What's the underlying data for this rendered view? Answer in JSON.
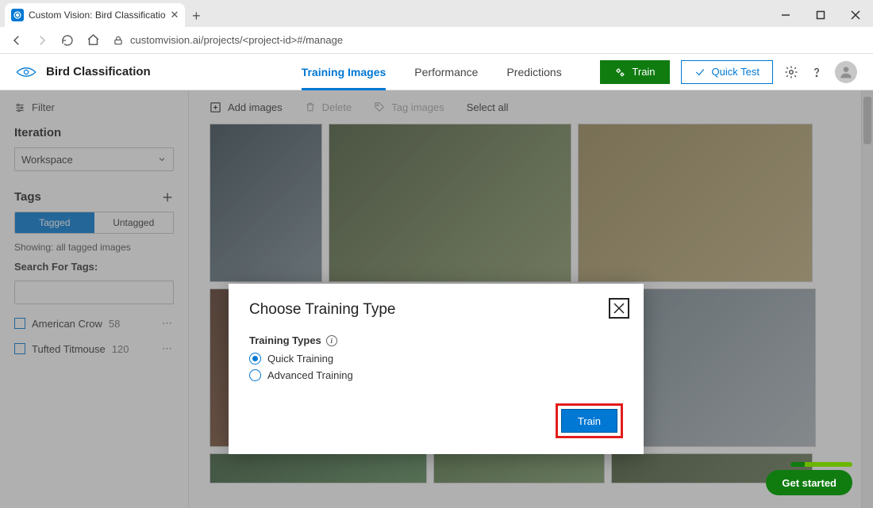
{
  "browser": {
    "tab_title": "Custom Vision: Bird Classificatio",
    "url": "customvision.ai/projects/<project-id>#/manage"
  },
  "header": {
    "project_name": "Bird Classification",
    "tabs": {
      "images": "Training Images",
      "performance": "Performance",
      "predictions": "Predictions"
    },
    "train_btn": "Train",
    "quick_test_btn": "Quick Test"
  },
  "sidebar": {
    "filter_label": "Filter",
    "iteration_label": "Iteration",
    "iteration_value": "Workspace",
    "tags_label": "Tags",
    "pill_tagged": "Tagged",
    "pill_untagged": "Untagged",
    "showing": "Showing: all tagged images",
    "search_label": "Search For Tags:",
    "tags": [
      {
        "name": "American Crow",
        "count": "58"
      },
      {
        "name": "Tufted Titmouse",
        "count": "120"
      }
    ]
  },
  "toolbar": {
    "add_images": "Add images",
    "delete": "Delete",
    "tag_images": "Tag images",
    "select_all": "Select all"
  },
  "modal": {
    "title": "Choose Training Type",
    "types_label": "Training Types",
    "opt_quick": "Quick Training",
    "opt_advanced": "Advanced Training",
    "train_btn": "Train"
  },
  "get_started": "Get started"
}
